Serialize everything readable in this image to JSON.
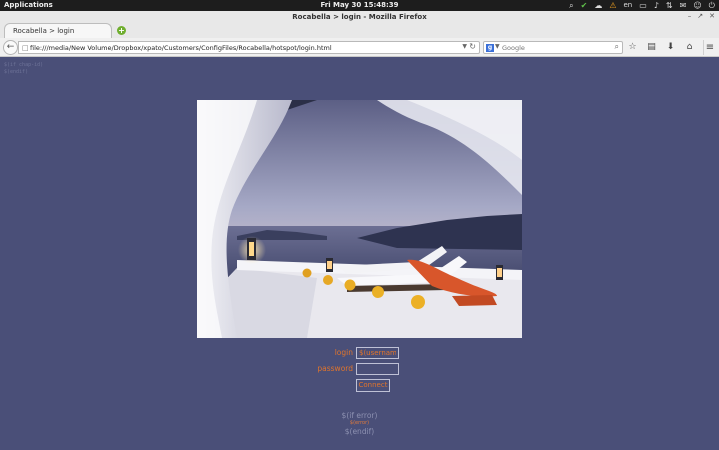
{
  "top_panel": {
    "applications": "Applications",
    "clock": "Fri May 30 15:48:39",
    "language": "en"
  },
  "window": {
    "title": "Rocabella > login - Mozilla Firefox"
  },
  "tabs": [
    {
      "label": "Rocabella > login"
    }
  ],
  "navbar": {
    "url": "file:///media/New Volume/Dropbox/xpato/Customers/ConfigFiles/Rocabella/hotspot/login.html",
    "search_placeholder": "Google"
  },
  "page": {
    "template_top_line1": "$(if chap-id)",
    "template_top_line2": "$(endif)",
    "login_label": "login",
    "login_value": "$(username)",
    "password_label": "password",
    "connect_label": "Connect",
    "if_error": "$(if error)",
    "error": "$(error)",
    "endif": "$(endif)"
  },
  "colors": {
    "page_background": "#4a4f78",
    "form_accent": "#e0742c"
  }
}
